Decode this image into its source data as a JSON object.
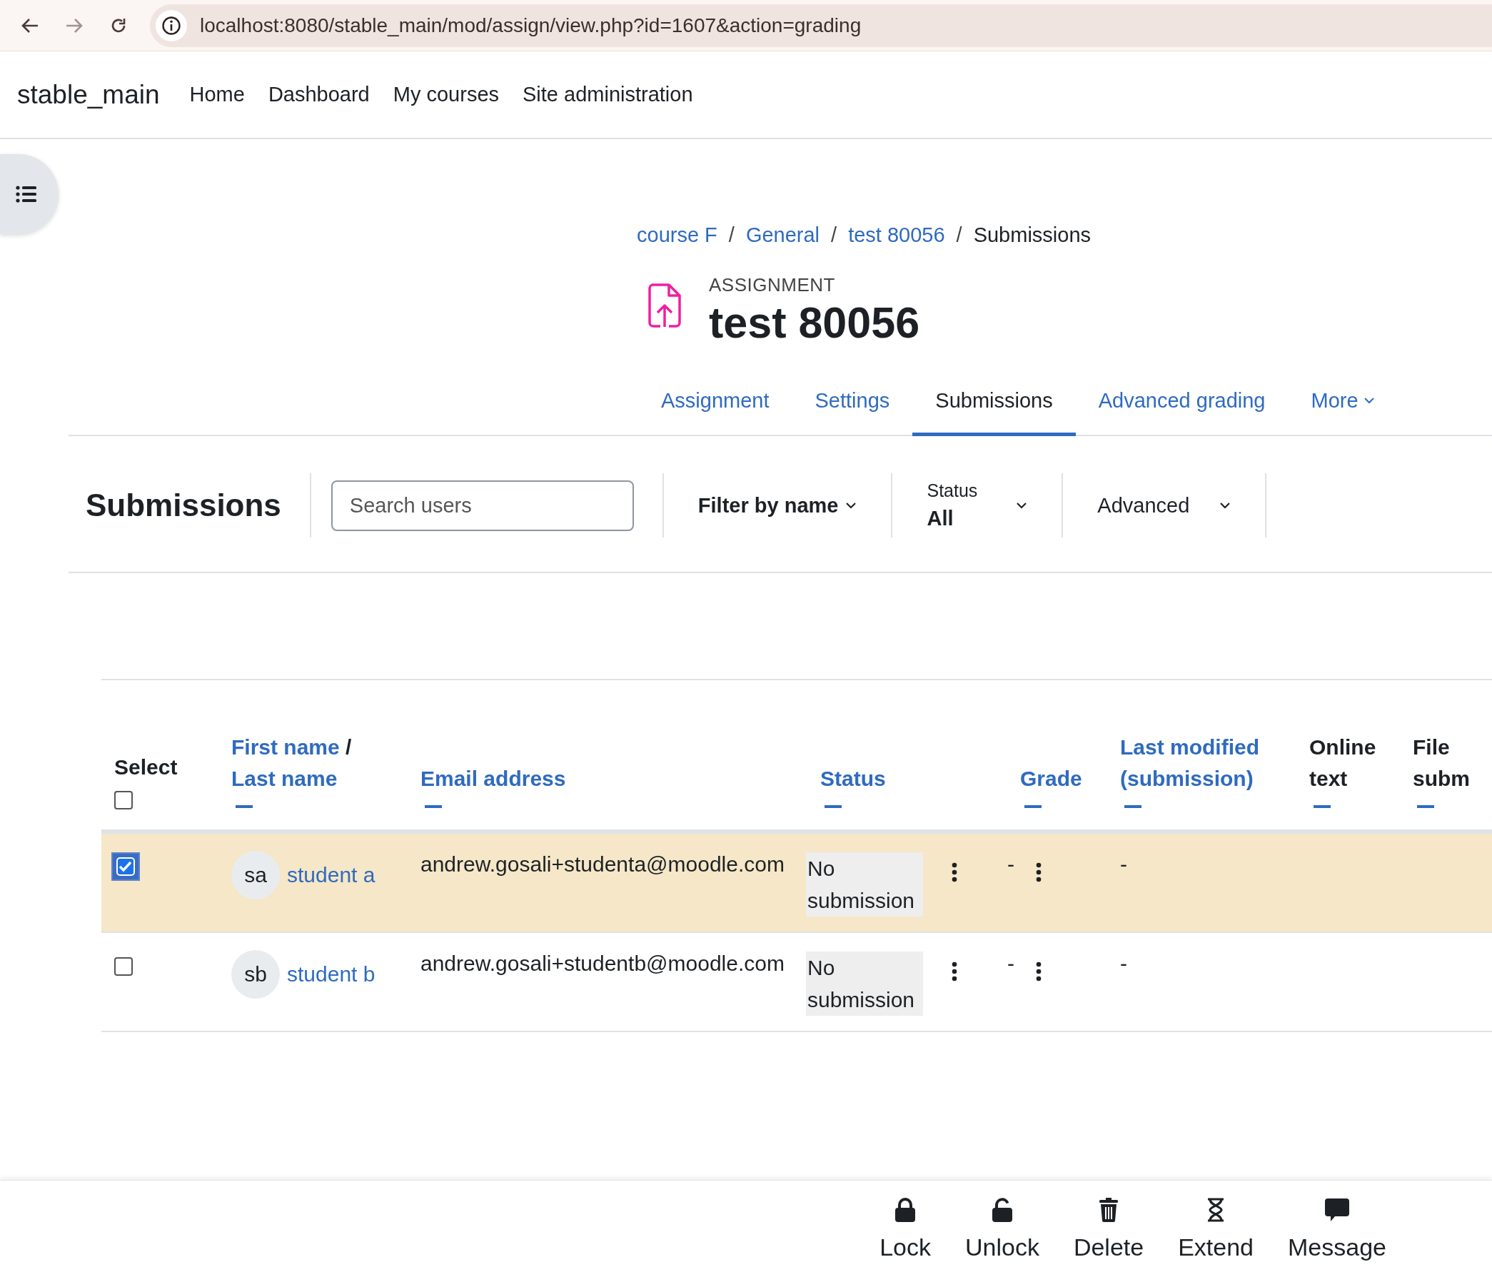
{
  "browser": {
    "url": "localhost:8080/stable_main/mod/assign/view.php?id=1607&action=grading"
  },
  "navbar": {
    "site_name": "stable_main",
    "items": [
      {
        "label": "Home"
      },
      {
        "label": "Dashboard"
      },
      {
        "label": "My courses"
      },
      {
        "label": "Site administration"
      }
    ]
  },
  "breadcrumb": {
    "separator": "/",
    "items": [
      {
        "label": "course F",
        "link": true
      },
      {
        "label": "General",
        "link": true
      },
      {
        "label": "test 80056",
        "link": true
      },
      {
        "label": "Submissions",
        "link": false
      }
    ]
  },
  "page_header": {
    "kicker": "ASSIGNMENT",
    "title": "test 80056"
  },
  "tabs": [
    {
      "label": "Assignment",
      "selected": false,
      "kind": "link"
    },
    {
      "label": "Settings",
      "selected": false,
      "kind": "link"
    },
    {
      "label": "Submissions",
      "selected": true,
      "kind": "link"
    },
    {
      "label": "Advanced grading",
      "selected": false,
      "kind": "link"
    },
    {
      "label": "More",
      "selected": false,
      "kind": "menu"
    }
  ],
  "filters": {
    "heading": "Submissions",
    "search": {
      "placeholder": "Search users"
    },
    "name_filter": "Filter by name",
    "status": {
      "label": "Status",
      "value": "All"
    },
    "advanced": "Advanced"
  },
  "table": {
    "select_all": false,
    "columns": [
      {
        "kind": "select",
        "label": "Select"
      },
      {
        "kind": "name",
        "first": "First name",
        "separator": "/",
        "last": "Last name"
      },
      {
        "kind": "sort",
        "label": "Email address"
      },
      {
        "kind": "sort",
        "label": "Status"
      },
      {
        "kind": "sort",
        "label": "Grade"
      },
      {
        "kind": "sort",
        "label": "Last modified (submission)"
      },
      {
        "kind": "plain",
        "label": "Online text"
      },
      {
        "kind": "plain",
        "label": "File subm"
      }
    ],
    "rows": [
      {
        "selected": true,
        "initials": "sa",
        "name": "student a",
        "email": "andrew.gosali+studenta@moodle.com",
        "status": "No submission",
        "grade": "-",
        "last_modified": "-"
      },
      {
        "selected": false,
        "initials": "sb",
        "name": "student b",
        "email": "andrew.gosali+studentb@moodle.com",
        "status": "No submission",
        "grade": "-",
        "last_modified": "-"
      }
    ]
  },
  "actions": [
    {
      "kind": "lock",
      "label": "Lock"
    },
    {
      "kind": "unlock",
      "label": "Unlock"
    },
    {
      "kind": "delete",
      "label": "Delete"
    },
    {
      "kind": "extend",
      "label": "Extend"
    },
    {
      "kind": "message",
      "label": "Message"
    }
  ]
}
